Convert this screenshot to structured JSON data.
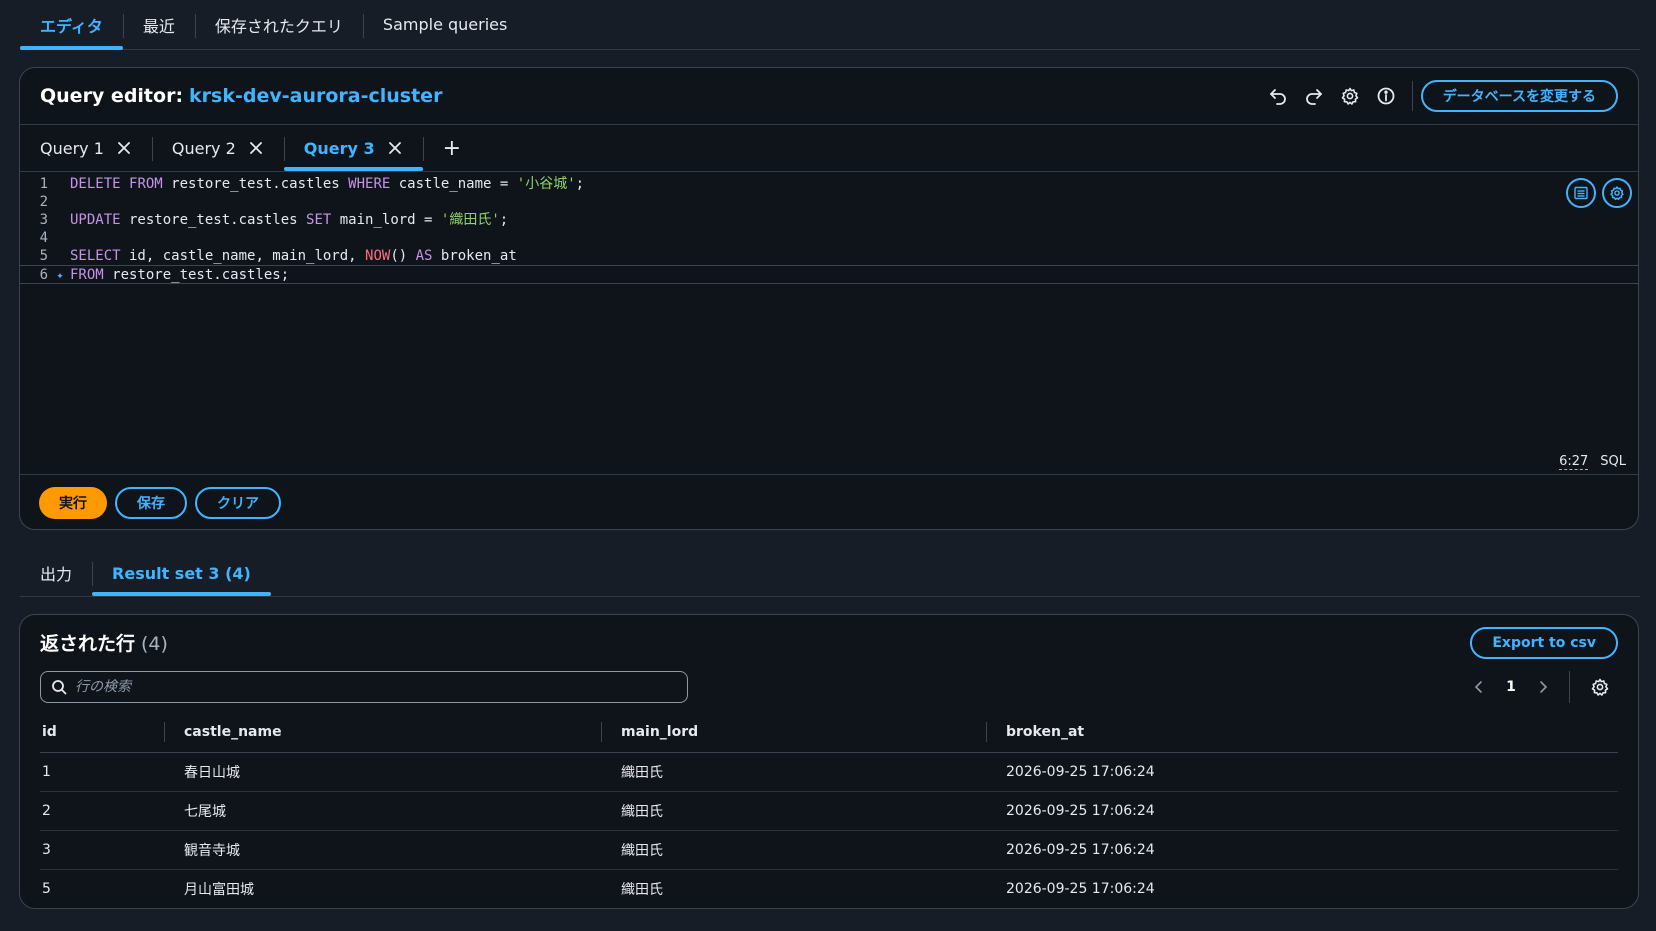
{
  "top_tabs": [
    {
      "label": "エディタ",
      "active": true
    },
    {
      "label": "最近"
    },
    {
      "label": "保存されたクエリ"
    },
    {
      "label": "Sample queries"
    }
  ],
  "editor": {
    "title": "Query editor:",
    "cluster": "krsk-dev-aurora-cluster",
    "change_db_label": "データベースを変更する",
    "tabs": [
      {
        "label": "Query 1"
      },
      {
        "label": "Query 2"
      },
      {
        "label": "Query 3",
        "active": true
      }
    ],
    "lines": {
      "l1": {
        "num": "1",
        "kw1": "DELETE",
        "kw2": "FROM",
        "t1": " restore_test.castles ",
        "kw3": "WHERE",
        "t2": " castle_name = ",
        "str": "'小谷城'",
        "t3": ";"
      },
      "l2": {
        "num": "2"
      },
      "l3": {
        "num": "3",
        "kw1": "UPDATE",
        "t1": " restore_test.castles ",
        "kw2": "SET",
        "t2": " main_lord = ",
        "str": "'織田氏'",
        "t3": ";"
      },
      "l4": {
        "num": "4"
      },
      "l5": {
        "num": "5",
        "kw1": "SELECT",
        "t1": " id, castle_name, main_lord, ",
        "fn": "NOW",
        "t2": "() ",
        "kw2": "AS",
        "t3": " broken_at"
      },
      "l6": {
        "num": "6",
        "kw1": "FROM",
        "t1": " restore_test.castles;"
      }
    },
    "cursor_pos": "6:27",
    "language": "SQL",
    "run_label": "実行",
    "save_label": "保存",
    "clear_label": "クリア"
  },
  "result_tabs": [
    {
      "label": "出力"
    },
    {
      "label": "Result set 3 (4)",
      "active": true
    }
  ],
  "results": {
    "title": "返された行",
    "count": "(4)",
    "export_label": "Export to csv",
    "search_placeholder": "行の検索",
    "page": "1",
    "columns": [
      "id",
      "castle_name",
      "main_lord",
      "broken_at"
    ],
    "rows": [
      [
        "1",
        "春日山城",
        "織田氏",
        "2026-09-25 17:06:24"
      ],
      [
        "2",
        "七尾城",
        "織田氏",
        "2026-09-25 17:06:24"
      ],
      [
        "3",
        "観音寺城",
        "織田氏",
        "2026-09-25 17:06:24"
      ],
      [
        "5",
        "月山富田城",
        "織田氏",
        "2026-09-25 17:06:24"
      ]
    ]
  },
  "colors": {
    "accent": "#42b4ff",
    "run": "#ff9900",
    "background": "#161d26",
    "panel": "#0f141a"
  }
}
